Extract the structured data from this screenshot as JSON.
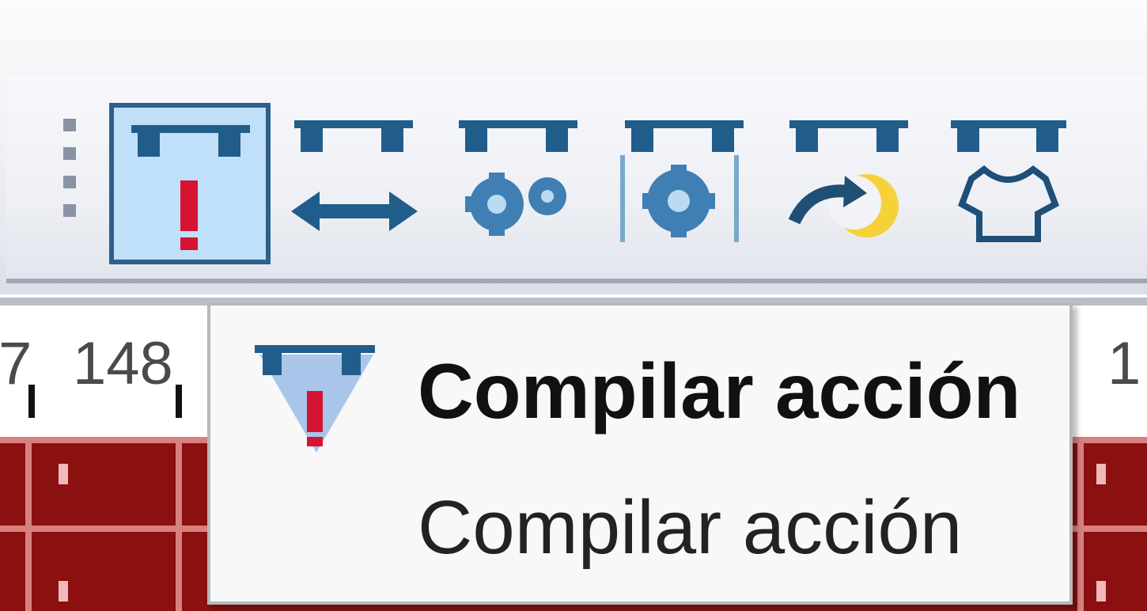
{
  "toolbar": {
    "buttons": [
      {
        "icon": "compile-action-icon",
        "active": true
      },
      {
        "icon": "width-action-icon",
        "active": false
      },
      {
        "icon": "gear-action-icon",
        "active": false
      },
      {
        "icon": "framed-gear-action-icon",
        "active": false
      },
      {
        "icon": "redo-action-icon",
        "active": false
      },
      {
        "icon": "shirt-action-icon",
        "active": false
      }
    ]
  },
  "ruler": {
    "left_partial": "7",
    "value": "148",
    "right_partial": "1"
  },
  "tooltip": {
    "title": "Compilar acción",
    "description": "Compilar acción"
  },
  "colors": {
    "active_bg": "#bfe0f8",
    "active_border": "#2f5f8c",
    "icon_blue": "#215d8a",
    "alert_red": "#d41432",
    "grid_red": "#8b1010"
  }
}
